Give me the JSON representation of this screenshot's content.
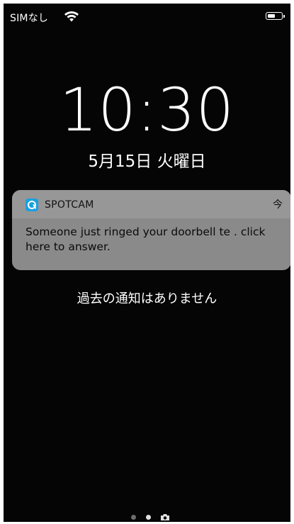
{
  "status_bar": {
    "carrier": "SIMなし",
    "wifi_icon": "wifi-icon",
    "battery_icon": "battery-icon",
    "battery_level": 0.6
  },
  "lock_screen": {
    "time": "10:30",
    "date": "5月15日 火曜日"
  },
  "notification": {
    "app_icon": "spotcam-app-icon",
    "app_name": "SPOTCAM",
    "time": "今",
    "body": "Someone just ringed your doorbell te . click here to answer."
  },
  "no_older_notifications": "過去の通知はありません",
  "page_indicator": {
    "pages": 2,
    "current": 2,
    "camera_icon": "camera-icon"
  }
}
